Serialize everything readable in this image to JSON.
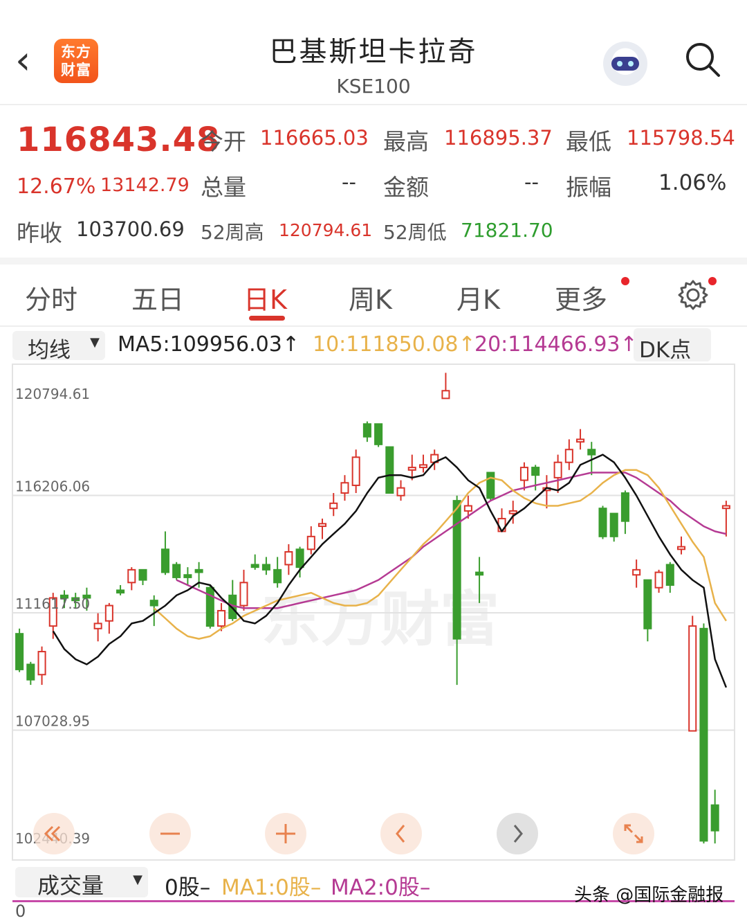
{
  "header": {
    "back_label": "‹",
    "logo_text_1": "东方",
    "logo_text_2": "财富",
    "title": "巴基斯坦卡拉奇",
    "subtitle": "KSE100",
    "assistant_icon": "robot-icon",
    "search_icon": "search-icon"
  },
  "quote": {
    "price": "116843.48",
    "change_pct": "12.67%",
    "change_abs": "13142.79",
    "prev_close_label": "昨收",
    "prev_close": "103700.69",
    "open_label": "今开",
    "open": "116665.03",
    "high_label": "最高",
    "high": "116895.37",
    "low_label": "最低",
    "low": "115798.54",
    "volume_label": "总量",
    "volume": "--",
    "amount_label": "金额",
    "amount": "--",
    "amplitude_label": "振幅",
    "amplitude": "1.06%",
    "w52_high_label": "52周高",
    "w52_high": "120794.61",
    "w52_low_label": "52周低",
    "w52_low": "71821.70"
  },
  "tabs": [
    {
      "label": "分时",
      "active": false
    },
    {
      "label": "五日",
      "active": false
    },
    {
      "label": "日K",
      "active": true
    },
    {
      "label": "周K",
      "active": false
    },
    {
      "label": "月K",
      "active": false
    },
    {
      "label": "更多",
      "active": false
    }
  ],
  "settings_icon": "gear-icon",
  "ma_bar": {
    "selector": "均线",
    "ma5": "MA5:109956.03↑",
    "ma10": "10:111850.08↑",
    "ma20": "20:114466.93↑",
    "dk": "DK点"
  },
  "colors": {
    "up": "#d9342b",
    "down": "#3a9d2e",
    "ma5": "#111111",
    "ma10": "#e8b24a",
    "ma20": "#b53a93",
    "accent": "#d9342b"
  },
  "chart_data": {
    "type": "candlestick",
    "ylim": [
      102440.39,
      120794.61
    ],
    "y_ticks": [
      "120794.61",
      "116206.06",
      "111617.50",
      "107028.95",
      "102440.39"
    ],
    "watermark": "东方财富",
    "candles": [
      {
        "o": 110800,
        "c": 109400,
        "h": 111000,
        "l": 109300
      },
      {
        "o": 109600,
        "c": 109000,
        "h": 109700,
        "l": 108800
      },
      {
        "o": 109200,
        "c": 110100,
        "h": 110300,
        "l": 108800
      },
      {
        "o": 111100,
        "c": 112200,
        "h": 112400,
        "l": 110600
      },
      {
        "o": 112300,
        "c": 112200,
        "h": 112500,
        "l": 111800
      },
      {
        "o": 112200,
        "c": 112100,
        "h": 112400,
        "l": 111800
      },
      {
        "o": 112300,
        "c": 112200,
        "h": 112600,
        "l": 111700
      },
      {
        "o": 111000,
        "c": 111200,
        "h": 111600,
        "l": 110500
      },
      {
        "o": 111300,
        "c": 111900,
        "h": 112000,
        "l": 110800
      },
      {
        "o": 112500,
        "c": 112400,
        "h": 112700,
        "l": 112300
      },
      {
        "o": 112800,
        "c": 113300,
        "h": 113400,
        "l": 112500
      },
      {
        "o": 113300,
        "c": 112900,
        "h": 113300,
        "l": 112700
      },
      {
        "o": 112100,
        "c": 111900,
        "h": 112300,
        "l": 111100
      },
      {
        "o": 114100,
        "c": 113200,
        "h": 114800,
        "l": 113100
      },
      {
        "o": 113500,
        "c": 113000,
        "h": 113600,
        "l": 112900
      },
      {
        "o": 113100,
        "c": 113000,
        "h": 113400,
        "l": 112700
      },
      {
        "o": 113300,
        "c": 113200,
        "h": 113600,
        "l": 112600
      },
      {
        "o": 112600,
        "c": 111100,
        "h": 112700,
        "l": 111000
      },
      {
        "o": 111100,
        "c": 111700,
        "h": 112000,
        "l": 110900
      },
      {
        "o": 112300,
        "c": 111400,
        "h": 112900,
        "l": 111300
      },
      {
        "o": 111900,
        "c": 112800,
        "h": 113300,
        "l": 111700
      },
      {
        "o": 113500,
        "c": 113400,
        "h": 113900,
        "l": 113300
      },
      {
        "o": 113500,
        "c": 113300,
        "h": 113800,
        "l": 113100
      },
      {
        "o": 113300,
        "c": 112800,
        "h": 113800,
        "l": 112600
      },
      {
        "o": 113500,
        "c": 114000,
        "h": 114300,
        "l": 113100
      },
      {
        "o": 114100,
        "c": 113400,
        "h": 114200,
        "l": 113000
      },
      {
        "o": 114100,
        "c": 114600,
        "h": 115000,
        "l": 113900
      },
      {
        "o": 115000,
        "c": 115100,
        "h": 115300,
        "l": 114500
      },
      {
        "o": 115700,
        "c": 115900,
        "h": 116300,
        "l": 115400
      },
      {
        "o": 116300,
        "c": 116700,
        "h": 117000,
        "l": 116000
      },
      {
        "o": 116600,
        "c": 117700,
        "h": 118000,
        "l": 116300
      },
      {
        "o": 119000,
        "c": 118500,
        "h": 119100,
        "l": 118300
      },
      {
        "o": 119000,
        "c": 118200,
        "h": 119000,
        "l": 118100
      },
      {
        "o": 118100,
        "c": 116300,
        "h": 118100,
        "l": 116300
      },
      {
        "o": 116200,
        "c": 116500,
        "h": 116800,
        "l": 116000
      },
      {
        "o": 117200,
        "c": 117300,
        "h": 117800,
        "l": 116800
      },
      {
        "o": 117300,
        "c": 117400,
        "h": 117800,
        "l": 117100
      },
      {
        "o": 117500,
        "c": 117800,
        "h": 118000,
        "l": 117200
      },
      {
        "o": 120000,
        "c": 120300,
        "h": 121000,
        "l": 120000
      },
      {
        "o": 116000,
        "c": 110600,
        "h": 116200,
        "l": 108800
      },
      {
        "o": 115600,
        "c": 115800,
        "h": 116200,
        "l": 115300
      },
      {
        "o": 113200,
        "c": 113100,
        "h": 113800,
        "l": 112000
      },
      {
        "o": 117100,
        "c": 116100,
        "h": 117100,
        "l": 116000
      },
      {
        "o": 114800,
        "c": 115300,
        "h": 115700,
        "l": 114800
      },
      {
        "o": 115500,
        "c": 115600,
        "h": 116000,
        "l": 115100
      },
      {
        "o": 116800,
        "c": 117300,
        "h": 117500,
        "l": 116400
      },
      {
        "o": 117300,
        "c": 117000,
        "h": 117400,
        "l": 116400
      },
      {
        "o": 116400,
        "c": 116500,
        "h": 117000,
        "l": 115700
      },
      {
        "o": 116900,
        "c": 117500,
        "h": 117800,
        "l": 116300
      },
      {
        "o": 117500,
        "c": 118000,
        "h": 118400,
        "l": 117200
      },
      {
        "o": 118300,
        "c": 118400,
        "h": 118800,
        "l": 118000
      },
      {
        "o": 118000,
        "c": 117800,
        "h": 118300,
        "l": 117000
      },
      {
        "o": 115700,
        "c": 114600,
        "h": 115800,
        "l": 114500
      },
      {
        "o": 115500,
        "c": 114600,
        "h": 115500,
        "l": 114400
      },
      {
        "o": 116300,
        "c": 115200,
        "h": 116400,
        "l": 114700
      },
      {
        "o": 113100,
        "c": 113300,
        "h": 113700,
        "l": 112600
      },
      {
        "o": 112900,
        "c": 111000,
        "h": 112900,
        "l": 110500
      },
      {
        "o": 112600,
        "c": 113200,
        "h": 113300,
        "l": 112400
      },
      {
        "o": 113500,
        "c": 112700,
        "h": 113600,
        "l": 112400
      },
      {
        "o": 114100,
        "c": 114200,
        "h": 114600,
        "l": 113900
      },
      {
        "o": 107000,
        "c": 111100,
        "h": 111500,
        "l": 107000
      },
      {
        "o": 111000,
        "c": 102700,
        "h": 111200,
        "l": 102600
      },
      {
        "o": 104100,
        "c": 103100,
        "h": 104700,
        "l": 102600
      },
      {
        "o": 115700,
        "c": 115800,
        "h": 116000,
        "l": 114600
      }
    ],
    "ma5": [
      110900,
      110200,
      109800,
      109600,
      109900,
      110400,
      110700,
      111200,
      111300,
      111600,
      111900,
      112300,
      112500,
      112800,
      112700,
      112200,
      111800,
      111300,
      111200,
      111500,
      112000,
      112700,
      113300,
      113800,
      114300,
      114700,
      115100,
      115600,
      116300,
      116900,
      117000,
      117000,
      116900,
      117000,
      117500,
      117700,
      117300,
      116800,
      116500,
      115600,
      114800,
      115400,
      115700,
      116100,
      116500,
      116400,
      116700,
      117400,
      117600,
      117800,
      117500,
      116900,
      116200,
      115400,
      114600,
      113900,
      113300,
      112900,
      112600,
      109800,
      108700
    ],
    "ma10": [
      111800,
      111400,
      111000,
      110700,
      110600,
      110700,
      111000,
      111200,
      111500,
      111700,
      111900,
      112100,
      112200,
      112300,
      112400,
      112200,
      112000,
      111900,
      111900,
      112000,
      112300,
      112800,
      113300,
      113800,
      114300,
      114700,
      115200,
      115700,
      116300,
      116700,
      116900,
      116800,
      116400,
      116100,
      115900,
      115800,
      115800,
      115900,
      116000,
      116300,
      116700,
      117000,
      117200,
      117200,
      117000,
      116500,
      115800,
      115100,
      114400,
      113800,
      112000,
      111300
    ],
    "ma20": [
      112900,
      112700,
      112500,
      112300,
      112100,
      111900,
      111800,
      111800,
      111800,
      111800,
      111900,
      112000,
      112100,
      112200,
      112300,
      112400,
      112500,
      112700,
      112900,
      113200,
      113500,
      113800,
      114200,
      114500,
      114800,
      115100,
      115400,
      115700,
      116000,
      116200,
      116400,
      116500,
      116600,
      116700,
      116800,
      116900,
      117000,
      117100,
      117100,
      117100,
      117100,
      116900,
      116600,
      116300,
      116000,
      115600,
      115300,
      115000,
      114800,
      114700
    ],
    "tools": [
      "double-left-icon",
      "minus-icon",
      "plus-icon",
      "chevron-left-icon",
      "chevron-right-icon",
      "expand-icon"
    ]
  },
  "volume": {
    "selector": "成交量",
    "value": "0股–",
    "ma1": "MA1:0股–",
    "ma2": "MA2:0股–",
    "axis_zero": "0"
  },
  "watermark_text": "头条 @国际金融报"
}
